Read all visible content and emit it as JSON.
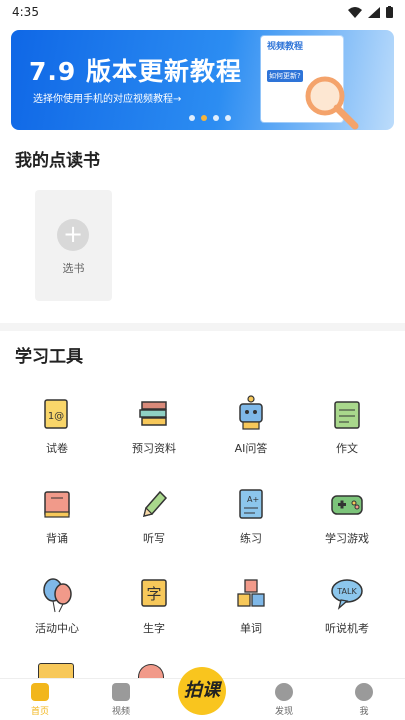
{
  "status_bar": {
    "time": "4:35"
  },
  "banner": {
    "title": "7.9 版本更新教程",
    "subtitle": "选择你使用手机的对应视频教程→",
    "card_title": "视频教程",
    "card_tag": "如何更新?"
  },
  "my_books": {
    "title": "我的点读书",
    "add_label": "选书"
  },
  "tools": {
    "title": "学习工具",
    "items": [
      {
        "label": "试卷",
        "icon": "exam-paper-icon"
      },
      {
        "label": "预习资料",
        "icon": "stacked-books-icon"
      },
      {
        "label": "AI问答",
        "icon": "robot-icon"
      },
      {
        "label": "作文",
        "icon": "essay-icon"
      },
      {
        "label": "背诵",
        "icon": "recite-book-icon"
      },
      {
        "label": "听写",
        "icon": "pencil-icon"
      },
      {
        "label": "练习",
        "icon": "practice-sheet-icon"
      },
      {
        "label": "学习游戏",
        "icon": "gamepad-icon"
      },
      {
        "label": "活动中心",
        "icon": "balloon-icon"
      },
      {
        "label": "生字",
        "icon": "character-card-icon"
      },
      {
        "label": "单词",
        "icon": "word-blocks-icon"
      },
      {
        "label": "听说机考",
        "icon": "talk-bubble-icon"
      }
    ]
  },
  "tabbar": {
    "home": "首页",
    "video": "视频",
    "center": "拍课",
    "discover": "发现",
    "me": "我"
  },
  "colors": {
    "accent": "#f2b61b",
    "banner_blue": "#1f78ea"
  }
}
